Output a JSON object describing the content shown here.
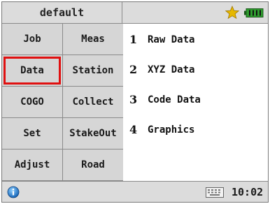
{
  "titlebar": {
    "profile": "default",
    "icons": [
      "star-icon",
      "battery-icon"
    ],
    "colors": {
      "star": "#e6b800",
      "battery": "#2e9e2e"
    }
  },
  "menu": {
    "buttons": [
      {
        "label": "Job",
        "selected": false
      },
      {
        "label": "Meas",
        "selected": false
      },
      {
        "label": "Data",
        "selected": true
      },
      {
        "label": "Station",
        "selected": false
      },
      {
        "label": "COGO",
        "selected": false
      },
      {
        "label": "Collect",
        "selected": false
      },
      {
        "label": "Set",
        "selected": false
      },
      {
        "label": "StakeOut",
        "selected": false
      },
      {
        "label": "Adjust",
        "selected": false
      },
      {
        "label": "Road",
        "selected": false
      }
    ],
    "selection_color": "#e01010"
  },
  "submenu": {
    "items": [
      {
        "num": "1",
        "label": "Raw Data"
      },
      {
        "num": "2",
        "label": "XYZ Data"
      },
      {
        "num": "3",
        "label": "Code Data"
      },
      {
        "num": "4",
        "label": "Graphics"
      }
    ]
  },
  "statusbar": {
    "time": "10:02",
    "icons": [
      "info-icon",
      "keyboard-icon"
    ]
  }
}
